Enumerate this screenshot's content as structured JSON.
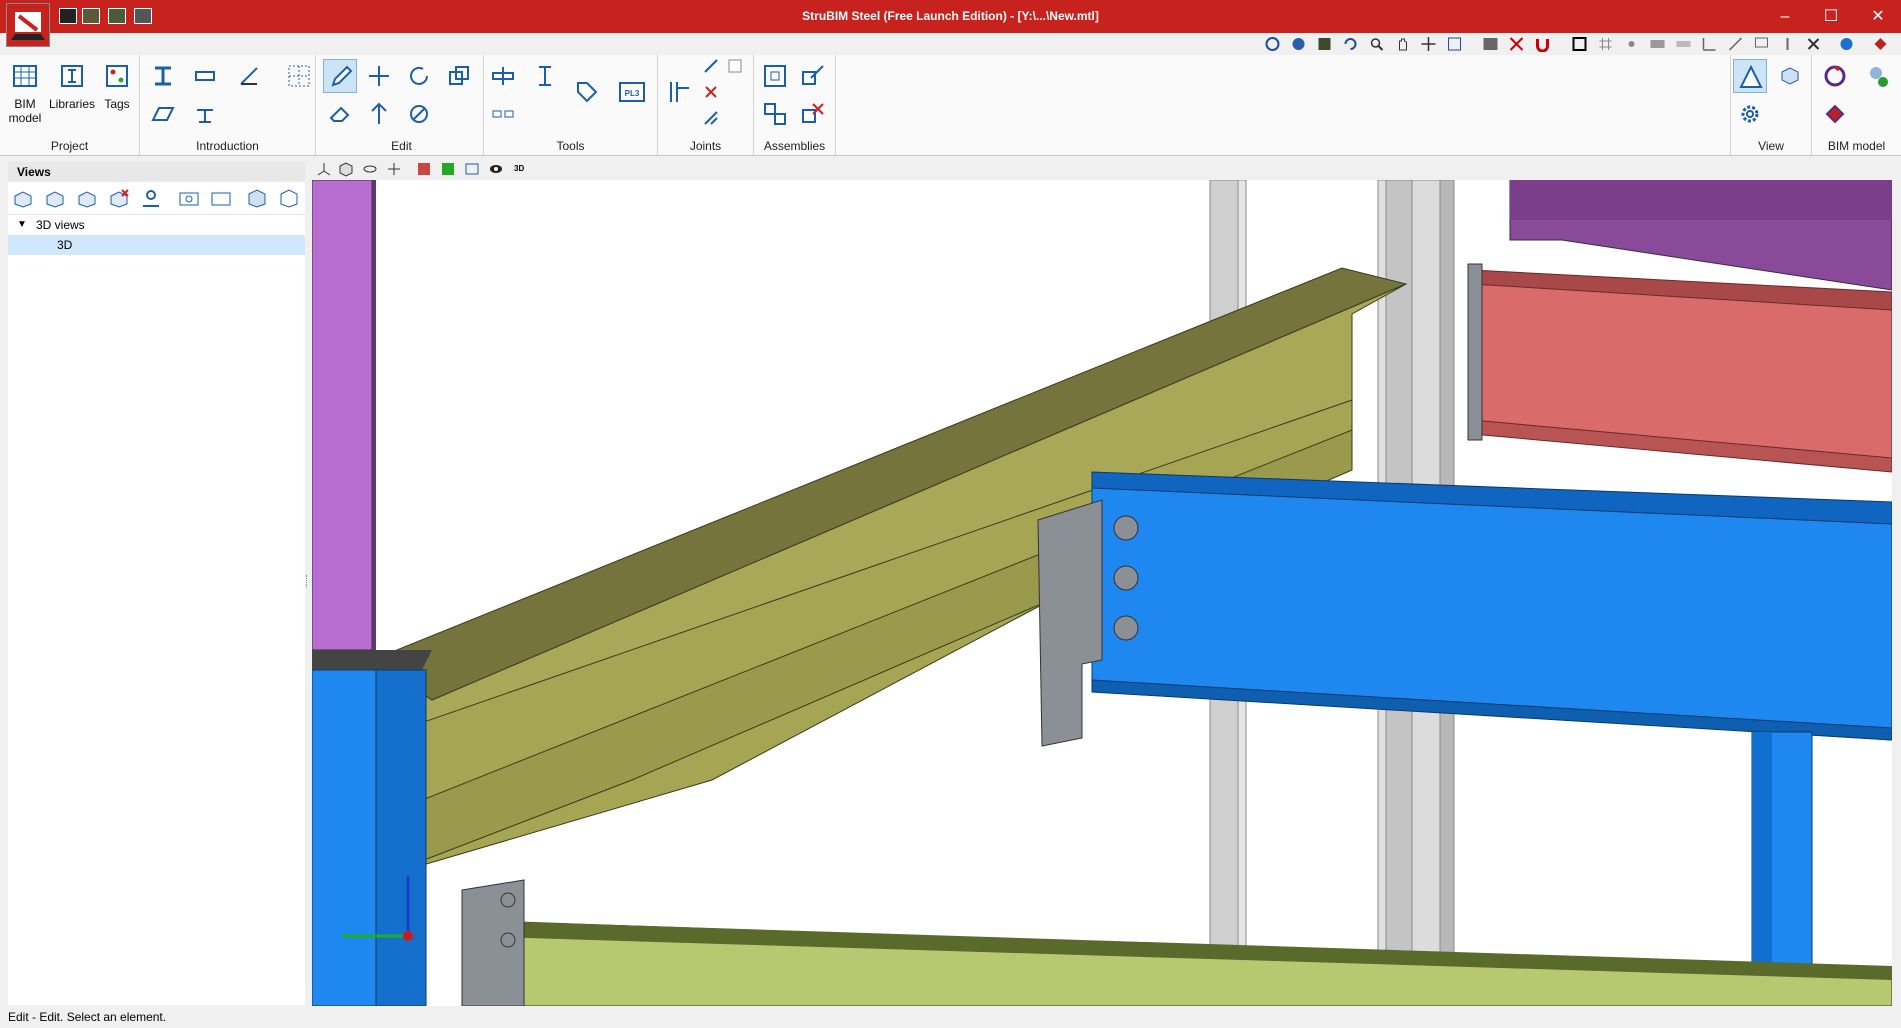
{
  "window": {
    "title": "StruBIM Steel (Free Launch Edition) - [Y:\\...\\New.mtl]",
    "controls": [
      "–",
      "☐",
      "✕"
    ]
  },
  "quick_access": [
    "save-icon",
    "export-icon",
    "import-icon",
    "print-icon"
  ],
  "ribbon": {
    "groups": [
      {
        "label": "Project",
        "buttons": [
          "BIM model",
          "Libraries",
          "Tags"
        ]
      },
      {
        "label": "Introduction"
      },
      {
        "label": "Edit"
      },
      {
        "label": "Tools"
      },
      {
        "label": "Joints"
      },
      {
        "label": "Assemblies"
      },
      {
        "label": "View"
      },
      {
        "label": "BIM model"
      }
    ],
    "bim_model_label": "BIM\nmodel",
    "libraries_label": "Libraries",
    "tags_label": "Tags",
    "pl3_label": "PL3"
  },
  "panel": {
    "title": "Views",
    "tree": {
      "group": "3D views",
      "item": "3D"
    }
  },
  "view_toolbar": {
    "label_3d": "3D"
  },
  "status": {
    "text": "Edit - Edit. Select an element."
  },
  "colors": {
    "titlebar": "#c8221f",
    "beam_olive": "#a5a553",
    "beam_blue": "#1e88f0",
    "beam_purple": "#b86dd0",
    "beam_red": "#d96b6b",
    "plate_grey": "#8b8f96",
    "column_grey": "#cfcfcf"
  }
}
